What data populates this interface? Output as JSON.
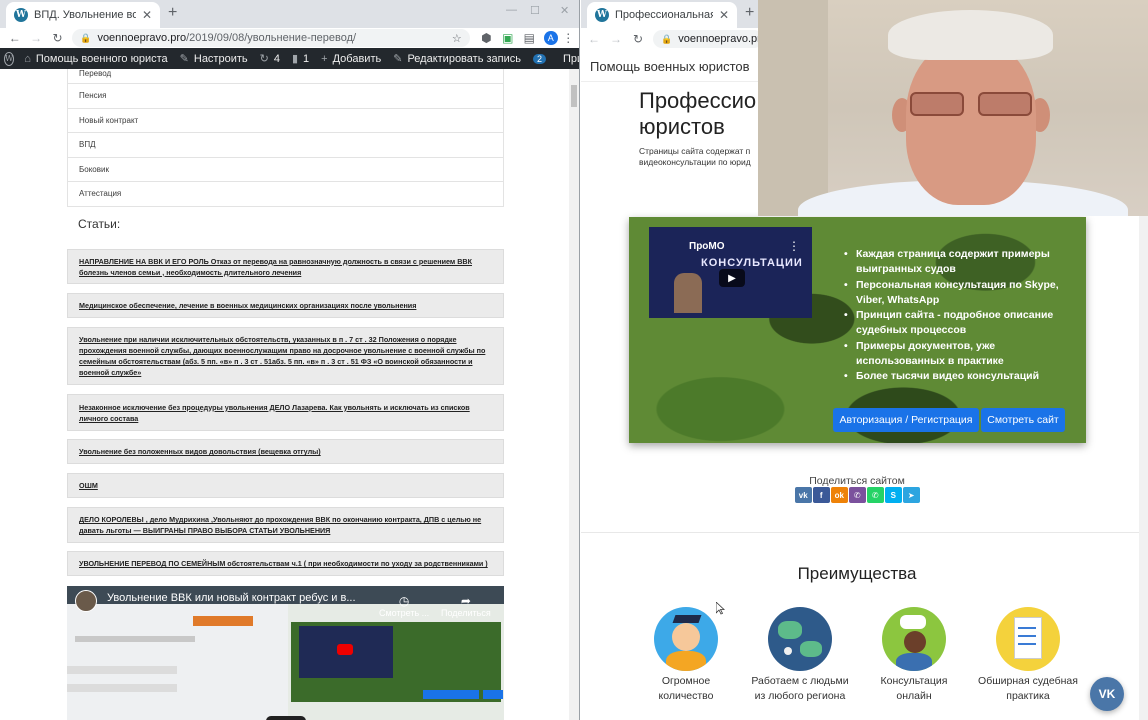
{
  "left_window": {
    "tab_title": "ВПД. Увольнение военнослуж",
    "url_host": "voennoepravo.pro",
    "url_path": "/2019/09/08/увольнение-перевод/",
    "profile_initial": "A",
    "admin_bar": {
      "site_name": "Помощь военного юриста",
      "customize": "Настроить",
      "updates": "4",
      "comments": "1",
      "add_new": "Добавить",
      "edit_post": "Редактировать запись",
      "notifications": "2",
      "greeting": "Привет, admin"
    },
    "categories": [
      "Перевод",
      "Пенсия",
      "Новый контракт",
      "ВПД",
      "Боковик",
      "Аттестация"
    ],
    "articles_heading": "Статьи:",
    "articles": [
      "НАПРАВЛЕНИЕ НА ВВК И ЕГО РОЛЬ Отказ от перевода на равнозначную должность в связи с решением ВВК болезнь членов семьи , необходимость длительного лечения",
      "Медицинское обеспечение, лечение в военных медицинских организациях после увольнения",
      "Увольнение при наличии исключительных обстоятельств, указанных в п . 7 ст . 32 Положения о порядке прохождения военной службы, дающих военнослужащим право на досрочное увольнение с военной службы по семейным обстоятельствам (абз. 5 пп. «в» п . 3 ст . 51абз. 5 пп. «в» п . 3 ст . 51 ФЗ «О воинской обязанности и военной службе»",
      "Незаконное исключение без процедуры увольнения ДЕЛО Лазарева. Как увольнять и исключать из списков личного состава",
      "Увольнение без положенных видов довольствия (вещевка отгулы)",
      "ОШМ",
      "ДЕЛО КОРОЛЕВЫ , дело Мудрихина ,Увольняют до прохождения ВВК по окончанию контракта, ДПВ с целью не давать льготы — ВЫИГРАНЫ ПРАВО ВЫБОРА СТАТЬИ УВОЛЬНЕНИЯ",
      "УВОЛЬНЕНИЕ ПЕРЕВОД ПО СЕМЕЙНЫМ обстоятельствам ч.1 ( при необходимости по уходу за родственниками )"
    ],
    "video": {
      "title": "Увольнение ВВК или новый контракт ребус и в...",
      "watch_later": "Смотреть ...",
      "share": "Поделиться"
    }
  },
  "right_window": {
    "tab_title": "Профессиональная помощь в",
    "url_host": "voennoepravo.pro",
    "site_header": "Помощь военных юристов",
    "hero_title_line1": "Профессио",
    "hero_title_line2": "юристов",
    "hero_sub_line1": "Страницы сайта содержат п",
    "hero_sub_line2": "видеоконсультации по юрид",
    "promo": {
      "video_brand": "ПроМО",
      "video_brand2": "КОНСУЛЬТАЦИИ",
      "bullets": [
        "Каждая страница содержит примеры выигранных судов",
        "Персональная консультация по Skype, Viber, WhatsApp",
        "Принцип сайта - подробное описание судебных процессов",
        "Примеры документов, уже использованных в практике",
        "Более тысячи видео консультаций"
      ],
      "login_button": "Авторизация / Регистрация",
      "view_button": "Смотреть сайт"
    },
    "share_label": "Поделиться сайтом",
    "share_icons": [
      "vk-icon",
      "facebook-icon",
      "odnoklassniki-icon",
      "viber-icon",
      "whatsapp-icon",
      "skype-icon",
      "telegram-icon"
    ],
    "advantages_title": "Преимущества",
    "advantages": [
      {
        "line1": "Огромное",
        "line2": "количество"
      },
      {
        "line1": "Работаем с людьми",
        "line2": "из любого региона"
      },
      {
        "line1": "Консультация",
        "line2": "онлайн"
      },
      {
        "line1": "Обширная судебная",
        "line2": "практика"
      }
    ],
    "vk_widget": "VK"
  },
  "colors": {
    "wp_admin_bar": "#23282d",
    "button_blue": "#1a73e8",
    "camo_green": "#5f8a35",
    "vk_blue": "#4a76a8"
  }
}
